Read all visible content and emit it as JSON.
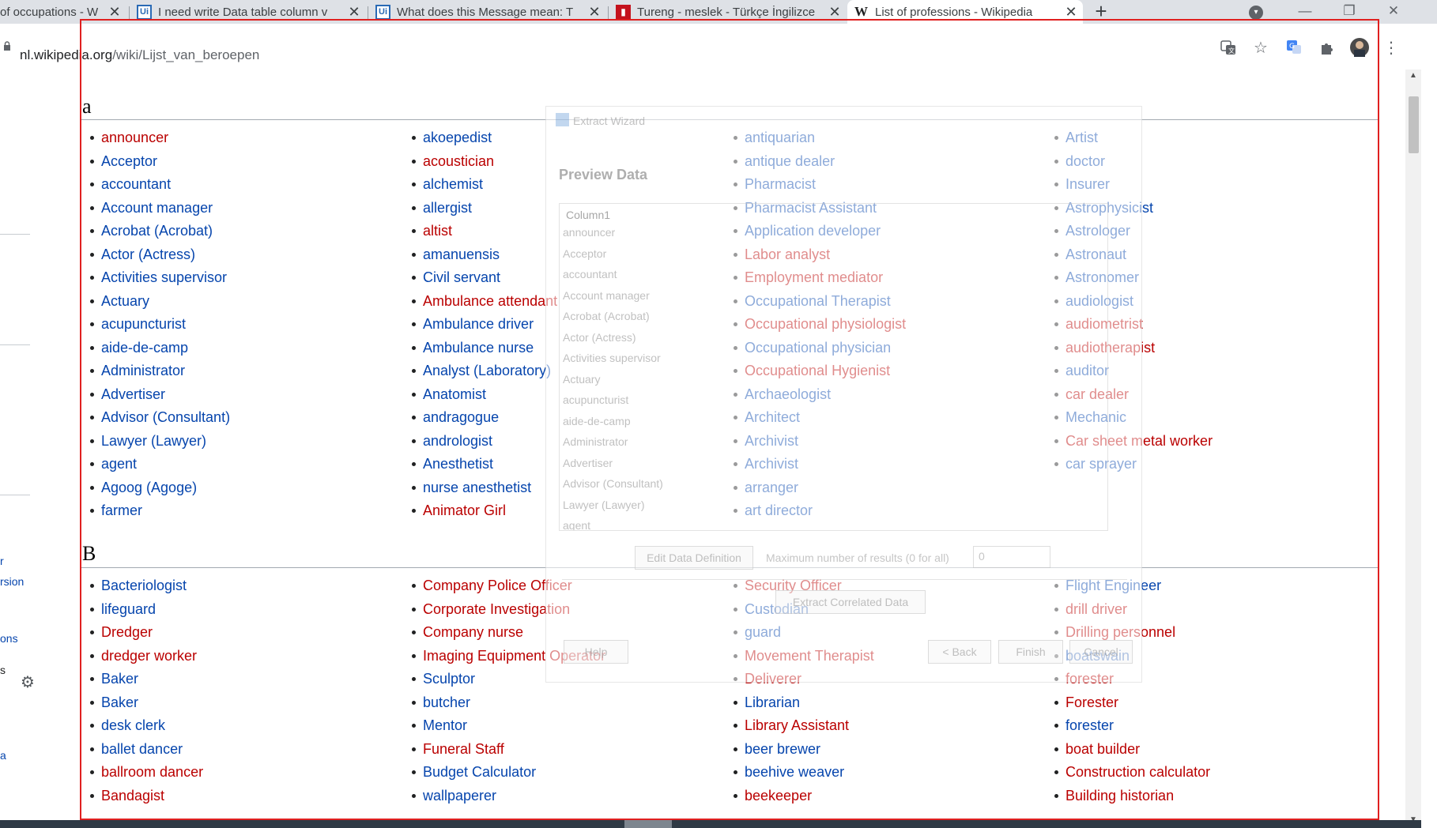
{
  "tabs": [
    {
      "title": "of occupations - W",
      "favicon": "generic"
    },
    {
      "title": "I need write Data table column v",
      "favicon": "Ui"
    },
    {
      "title": "What does this Message mean: T",
      "favicon": "Ui"
    },
    {
      "title": "Tureng - meslek - Türkçe İngilizce",
      "favicon": "tureng"
    },
    {
      "title": "List of professions - Wikipedia",
      "favicon": "W",
      "active": true
    }
  ],
  "toolbar": {
    "url_host": "nl.wikipedia.org",
    "url_path": "/wiki/Lijst_van_beroepen"
  },
  "icons": {
    "new_tab": "+",
    "tab_close": "✕",
    "minimize": "—",
    "restore": "❐",
    "close": "✕",
    "translate": "translate-icon",
    "star": "☆",
    "extension": "puzzle-icon",
    "menu": "⋮",
    "gear": "⚙"
  },
  "sidebar": {
    "items": [
      "r",
      "rsion",
      "ons",
      "s",
      "a"
    ]
  },
  "wizard": {
    "title": "Extract Wizard",
    "heading": "Preview Data",
    "column_header": "Column1",
    "rows": [
      "announcer",
      "Acceptor",
      "accountant",
      "Account manager",
      "Acrobat (Acrobat)",
      "Actor (Actress)",
      "Activities supervisor",
      "Actuary",
      "acupuncturist",
      "aide-de-camp",
      "Administrator",
      "Advertiser",
      "Advisor (Consultant)",
      "Lawyer (Lawyer)",
      "agent"
    ],
    "edit_button": "Edit Data Definition",
    "max_label": "Maximum number of results (0 for all)",
    "max_value": "0",
    "correlated_button": "Extract Correlated Data",
    "help_button": "Help",
    "back_button": "< Back",
    "finish_button": "Finish",
    "cancel_button": "Cancel"
  },
  "sections": [
    {
      "heading": "a",
      "columns": [
        [
          {
            "text": "announcer",
            "red": true
          },
          {
            "text": "Acceptor",
            "red": false
          },
          {
            "text": "accountant",
            "red": false
          },
          {
            "text": "Account manager",
            "red": false
          },
          {
            "text": "Acrobat (Acrobat)",
            "red": false
          },
          {
            "text": "Actor (Actress)",
            "red": false
          },
          {
            "text": "Activities supervisor",
            "red": false
          },
          {
            "text": "Actuary",
            "red": false
          },
          {
            "text": "acupuncturist",
            "red": false
          },
          {
            "text": "aide-de-camp",
            "red": false
          },
          {
            "text": "Administrator",
            "red": false
          },
          {
            "text": "Advertiser",
            "red": false
          },
          {
            "text": "Advisor (Consultant)",
            "red": false
          },
          {
            "text": "Lawyer (Lawyer)",
            "red": false
          },
          {
            "text": "agent",
            "red": false
          },
          {
            "text": "Agoog (Agoge)",
            "red": false
          },
          {
            "text": "farmer",
            "red": false
          }
        ],
        [
          {
            "text": "akoepedist",
            "red": false
          },
          {
            "text": "acoustician",
            "red": true
          },
          {
            "text": "alchemist",
            "red": false
          },
          {
            "text": "allergist",
            "red": false
          },
          {
            "text": "altist",
            "red": true
          },
          {
            "text": "amanuensis",
            "red": false
          },
          {
            "text": "Civil servant",
            "red": false
          },
          {
            "text": "Ambulance attendant",
            "red": true
          },
          {
            "text": "Ambulance driver",
            "red": false
          },
          {
            "text": "Ambulance nurse",
            "red": false
          },
          {
            "text": "Analyst (Laboratory)",
            "red": false
          },
          {
            "text": "Anatomist",
            "red": false
          },
          {
            "text": "andragogue",
            "red": false
          },
          {
            "text": "andrologist",
            "red": false
          },
          {
            "text": "Anesthetist",
            "red": false
          },
          {
            "text": "nurse anesthetist",
            "red": false
          },
          {
            "text": "Animator Girl",
            "red": true
          }
        ],
        [
          {
            "text": "antiquarian",
            "red": false
          },
          {
            "text": "antique dealer",
            "red": false
          },
          {
            "text": "Pharmacist",
            "red": false
          },
          {
            "text": "Pharmacist Assistant",
            "red": false
          },
          {
            "text": "Application developer",
            "red": false
          },
          {
            "text": "Labor analyst",
            "red": true
          },
          {
            "text": "Employment mediator",
            "red": true
          },
          {
            "text": "Occupational Therapist",
            "red": false
          },
          {
            "text": "Occupational physiologist",
            "red": true
          },
          {
            "text": "Occupational physician",
            "red": false
          },
          {
            "text": "Occupational Hygienist",
            "red": true
          },
          {
            "text": "Archaeologist",
            "red": false
          },
          {
            "text": "Architect",
            "red": false
          },
          {
            "text": "Archivist",
            "red": false
          },
          {
            "text": "Archivist",
            "red": false
          },
          {
            "text": "arranger",
            "red": false
          },
          {
            "text": "art director",
            "red": false
          }
        ],
        [
          {
            "text": "Artist",
            "red": false
          },
          {
            "text": "doctor",
            "red": false
          },
          {
            "text": "Insurer",
            "red": false
          },
          {
            "text": "Astrophysicist",
            "red": false
          },
          {
            "text": "Astrologer",
            "red": false
          },
          {
            "text": "Astronaut",
            "red": false
          },
          {
            "text": "Astronomer",
            "red": false
          },
          {
            "text": "audiologist",
            "red": false
          },
          {
            "text": "audiometrist",
            "red": true
          },
          {
            "text": "audiotherapist",
            "red": true
          },
          {
            "text": "auditor",
            "red": false
          },
          {
            "text": "car dealer",
            "red": true
          },
          {
            "text": "Mechanic",
            "red": false
          },
          {
            "text": "Car sheet metal worker",
            "red": true
          },
          {
            "text": "car sprayer",
            "red": false
          }
        ]
      ]
    },
    {
      "heading": "B",
      "columns": [
        [
          {
            "text": "Bacteriologist",
            "red": false
          },
          {
            "text": "lifeguard",
            "red": false
          },
          {
            "text": "Dredger",
            "red": true
          },
          {
            "text": "dredger worker",
            "red": true
          },
          {
            "text": "Baker",
            "red": false
          },
          {
            "text": "Baker",
            "red": false
          },
          {
            "text": "desk clerk",
            "red": false
          },
          {
            "text": "ballet dancer",
            "red": false
          },
          {
            "text": "ballroom dancer",
            "red": true
          },
          {
            "text": "Bandagist",
            "red": true
          }
        ],
        [
          {
            "text": "Company Police Officer",
            "red": true
          },
          {
            "text": "Corporate Investigation",
            "red": true
          },
          {
            "text": "Company nurse",
            "red": true
          },
          {
            "text": "Imaging Equipment Operator",
            "red": true
          },
          {
            "text": "Sculptor",
            "red": false
          },
          {
            "text": "butcher",
            "red": false
          },
          {
            "text": "Mentor",
            "red": false
          },
          {
            "text": "Funeral Staff",
            "red": true
          },
          {
            "text": "Budget Calculator",
            "red": false
          },
          {
            "text": "wallpaperer",
            "red": false
          }
        ],
        [
          {
            "text": "Security Officer",
            "red": true
          },
          {
            "text": "Custodian",
            "red": false
          },
          {
            "text": "guard",
            "red": false
          },
          {
            "text": "Movement Therapist",
            "red": true
          },
          {
            "text": "Deliverer",
            "red": true
          },
          {
            "text": "Librarian",
            "red": false
          },
          {
            "text": "Library Assistant",
            "red": true
          },
          {
            "text": "beer brewer",
            "red": false
          },
          {
            "text": "beehive weaver",
            "red": false
          },
          {
            "text": "beekeeper",
            "red": true
          }
        ],
        [
          {
            "text": "Flight Engineer",
            "red": false
          },
          {
            "text": "drill driver",
            "red": true
          },
          {
            "text": "Drilling personnel",
            "red": true
          },
          {
            "text": "boatswain",
            "red": false
          },
          {
            "text": "forester",
            "red": true
          },
          {
            "text": "Forester",
            "red": true
          },
          {
            "text": "forester",
            "red": false
          },
          {
            "text": "boat builder",
            "red": true
          },
          {
            "text": "Construction calculator",
            "red": true
          },
          {
            "text": "Building historian",
            "red": true
          }
        ]
      ]
    }
  ]
}
